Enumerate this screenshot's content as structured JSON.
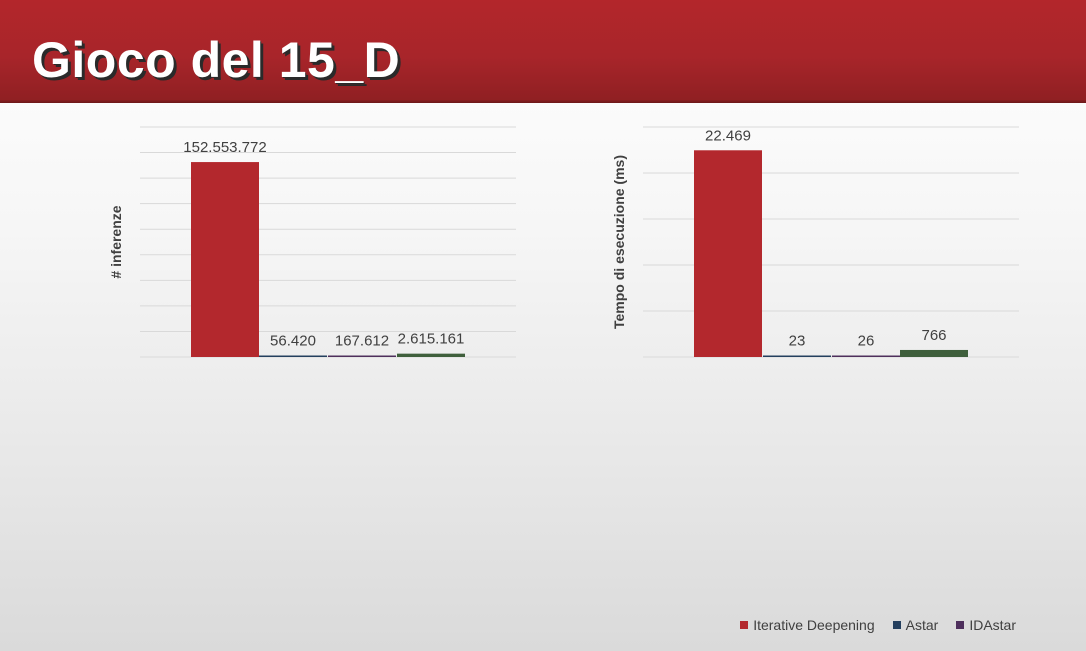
{
  "slide": {
    "title": "Gioco del 15_D"
  },
  "colors": {
    "header": "#a8252a",
    "gridline": "#d9d9d9",
    "label": "#404040"
  },
  "legend": {
    "items": [
      {
        "label": "Iterative Deepening",
        "color": "#b3282d"
      },
      {
        "label": "Astar",
        "color": "#243f5e"
      },
      {
        "label": "IDAstar",
        "color": "#4e2f5c"
      }
    ]
  },
  "chart_data": [
    {
      "type": "bar",
      "ylabel": "# inferenze",
      "ylim": [
        0,
        180000000
      ],
      "grid": true,
      "legend_placement": "bottom-right",
      "bars": [
        {
          "value": 152553772,
          "label": "152.553.772",
          "color": "#b3282d"
        },
        {
          "value": 56420,
          "label": "56.420",
          "color": "#243f5e"
        },
        {
          "value": 167612,
          "label": "167.612",
          "color": "#4e2f5c"
        },
        {
          "value": 2615161,
          "label": "2.615.161",
          "color": "#3f5f3c"
        }
      ]
    },
    {
      "type": "bar",
      "ylabel": "Tempo di esecuzione (ms)",
      "ylim": [
        0,
        25000
      ],
      "grid": true,
      "legend_placement": "bottom-right",
      "bars": [
        {
          "value": 22469,
          "label": "22.469",
          "color": "#b3282d"
        },
        {
          "value": 23,
          "label": "23",
          "color": "#243f5e"
        },
        {
          "value": 26,
          "label": "26",
          "color": "#4e2f5c"
        },
        {
          "value": 766,
          "label": "766",
          "color": "#3f5f3c"
        }
      ]
    }
  ]
}
